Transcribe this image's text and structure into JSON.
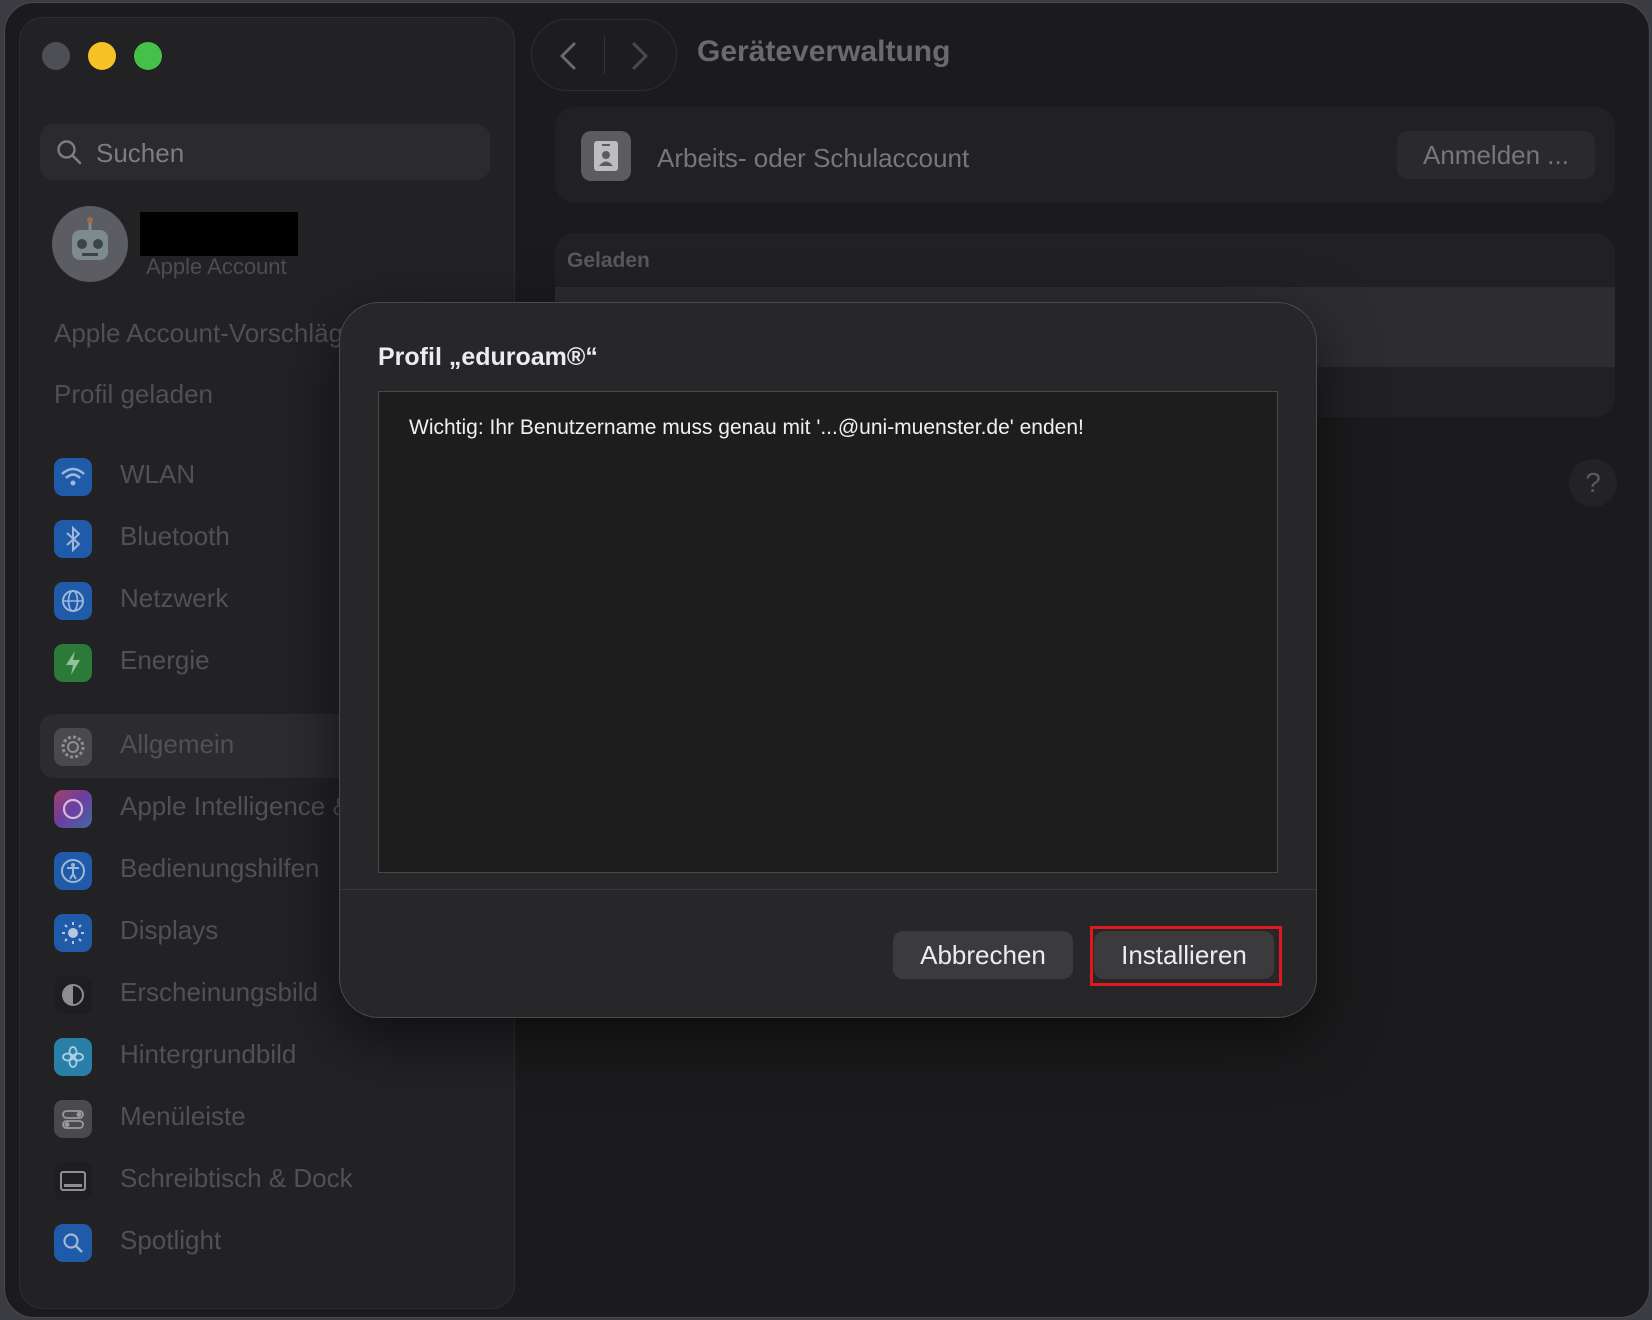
{
  "sidebar": {
    "search_placeholder": "Suchen",
    "account_sub": "Apple Account",
    "suggestions": "Apple Account-Vorschläge",
    "profile_loaded": "Profil geladen",
    "items": [
      {
        "label": "WLAN",
        "icon": "wifi-icon",
        "color": "#1f5ba8"
      },
      {
        "label": "Bluetooth",
        "icon": "bluetooth-icon",
        "color": "#1f5ba8"
      },
      {
        "label": "Netzwerk",
        "icon": "globe-icon",
        "color": "#1f5ba8"
      },
      {
        "label": "Energie",
        "icon": "bolt-icon",
        "color": "#2c7a37"
      },
      {
        "label": "Allgemein",
        "icon": "gear-icon",
        "color": "#4a4a4d"
      },
      {
        "label": "Apple Intelligence & Siri",
        "icon": "apple-intelligence-icon",
        "color": "#6b3fa0"
      },
      {
        "label": "Bedienungshilfen",
        "icon": "accessibility-icon",
        "color": "#1f5ba8"
      },
      {
        "label": "Displays",
        "icon": "sun-icon",
        "color": "#1f5ba8"
      },
      {
        "label": "Erscheinungsbild",
        "icon": "appearance-icon",
        "color": "#1e1e20"
      },
      {
        "label": "Hintergrundbild",
        "icon": "flower-icon",
        "color": "#2a7fa8"
      },
      {
        "label": "Menüleiste",
        "icon": "toggles-icon",
        "color": "#4a4a4d"
      },
      {
        "label": "Schreibtisch & Dock",
        "icon": "dock-icon",
        "color": "#1e1e20"
      },
      {
        "label": "Spotlight",
        "icon": "magnifier-icon",
        "color": "#1f5ba8"
      }
    ]
  },
  "main": {
    "title": "Geräteverwaltung",
    "account_label": "Arbeits- oder Schulaccount",
    "login_button": "Anmelden ...",
    "loaded_header": "Geladen",
    "help": "?"
  },
  "dialog": {
    "title": "Profil „eduroam®“",
    "message": "Wichtig: Ihr Benutzername muss genau mit '...@uni-muenster.de' enden!",
    "cancel": "Abbrechen",
    "install": "Installieren"
  },
  "colors": {
    "highlight": "#e0171e",
    "traffic_close": "#4e4f55",
    "traffic_minimize": "#f5c323",
    "traffic_maximize": "#45c14a"
  }
}
